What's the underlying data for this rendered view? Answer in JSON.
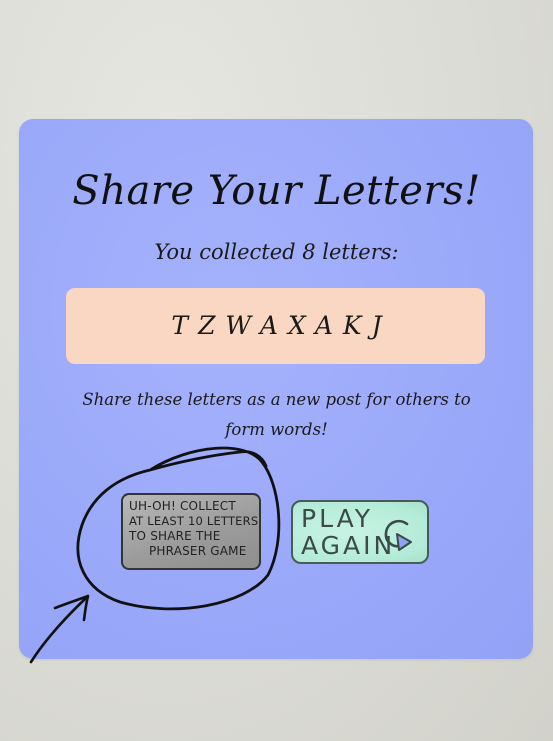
{
  "title": "Share Your Letters!",
  "subtitle": "You collected 8 letters:",
  "letters": "TZWAXAKJ",
  "share_text": "Share these letters as a new post for others to form words!",
  "collect_button": {
    "lines": [
      "UH-OH! COLLECT",
      "AT LEAST 10 LETTERS",
      "TO SHARE THE",
      "PHRASER GAME"
    ]
  },
  "play_button": {
    "line1": "PLAY",
    "line2": "AGAIN"
  },
  "icons": {
    "replay": "replay-arrow-icon",
    "circle": "hand-drawn-circle",
    "arrow": "hand-drawn-arrow"
  },
  "colors": {
    "card": "#9aa8fa",
    "letters_box": "#fad7c2",
    "play_button": "#b4ecd8",
    "collect_button": "#9c9c9c"
  }
}
